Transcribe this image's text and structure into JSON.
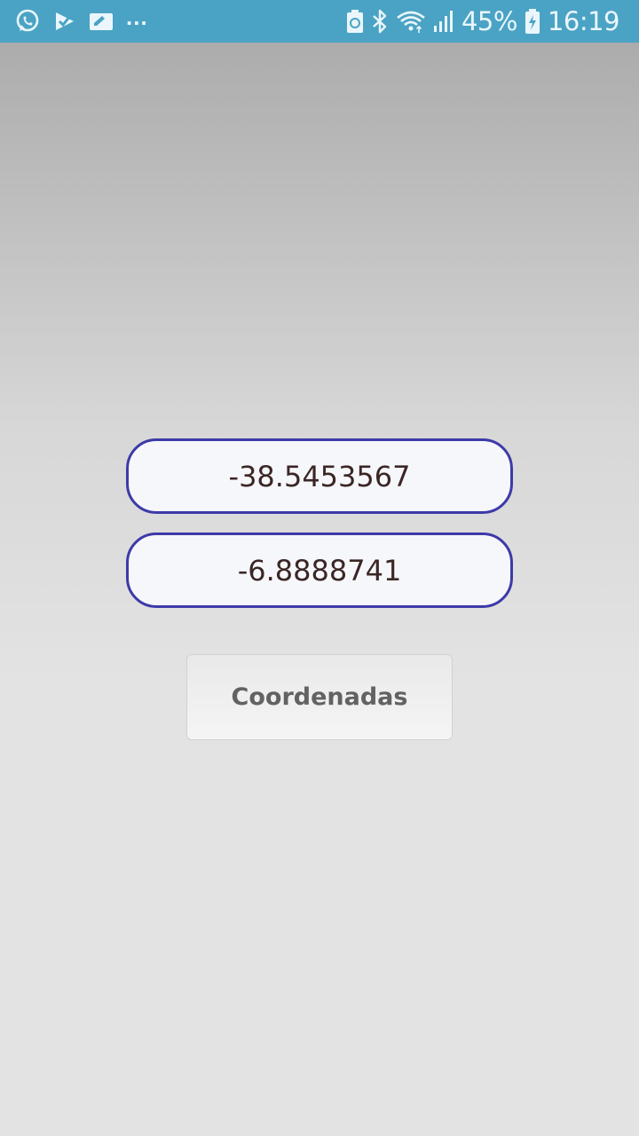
{
  "status_bar": {
    "left_icons": [
      "whatsapp-icon",
      "check-notification-icon",
      "edit-card-icon"
    ],
    "overflow": "...",
    "right_icons": [
      "recycle-battery-saver-icon",
      "bluetooth-icon",
      "wifi-icon",
      "signal-icon",
      "battery-icon"
    ],
    "battery_percent": "45%",
    "time": "16:19",
    "color": "#4aa3c4"
  },
  "form": {
    "latitude_value": "-38.5453567",
    "longitude_value": "-6.8888741",
    "button_label": "Coordenadas",
    "field_border_color": "#3d3aa8"
  }
}
